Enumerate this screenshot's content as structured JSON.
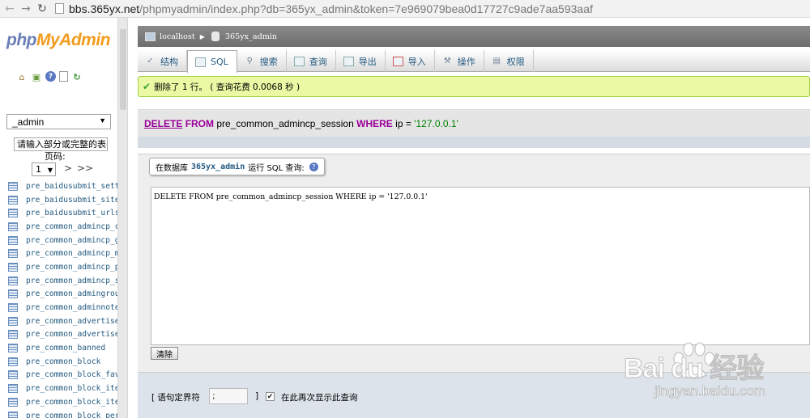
{
  "browser": {
    "url_host": "bbs.365yx.net",
    "url_rest": "/phpmyadmin/index.php?db=365yx_admin&token=7e969079bea0d17727c9ade7aa593aaf"
  },
  "sidebar": {
    "logo": {
      "php": "php",
      "my": "My",
      "admin": "Admin"
    },
    "db_selected": "_admin",
    "filter_placeholder": "请输入部分或完整的表名",
    "page_label": "页码:",
    "page_value": "1",
    "page_next": ">",
    "page_last": ">>",
    "tables": [
      "pre_baidusubmit_setting",
      "pre_baidusubmit_sitemap",
      "pre_baidusubmit_urlstat",
      "pre_common_admincp_cmenu",
      "pre_common_admincp_group",
      "pre_common_admincp_member",
      "pre_common_admincp_perm",
      "pre_common_admincp_session",
      "pre_common_admingroup",
      "pre_common_adminnote",
      "pre_common_advertisement",
      "pre_common_advertisement_custom",
      "pre_common_banned",
      "pre_common_block",
      "pre_common_block_favorite",
      "pre_common_block_item",
      "pre_common_block_item_data",
      "pre_common_block_permission",
      "pre_common_block_pic"
    ]
  },
  "breadcrumb": {
    "server": "localhost",
    "database": "365yx_admin"
  },
  "tabs": [
    {
      "label": "结构"
    },
    {
      "label": "SQL"
    },
    {
      "label": "搜索"
    },
    {
      "label": "查询"
    },
    {
      "label": "导出"
    },
    {
      "label": "导入"
    },
    {
      "label": "操作"
    },
    {
      "label": "权限"
    }
  ],
  "message": {
    "text": "删除了 1 行。 ( 查询花费 0.0068 秒 )"
  },
  "sql_display": {
    "kw_delete": "DELETE",
    "kw_from": "FROM",
    "table": "pre_common_admincp_session",
    "kw_where": "WHERE",
    "column": "ip",
    "op": "=",
    "value": "'127.0.0.1'"
  },
  "query_panel": {
    "legend_prefix": "在数据库",
    "legend_db": "365yx_admin",
    "legend_suffix": "运行 SQL 查询:",
    "query_text": "DELETE FROM pre_common_admincp_session WHERE ip = '127.0.0.1'",
    "clear_label": "清除"
  },
  "options": {
    "delimiter_label": "[ 语句定界符",
    "delimiter_value": ";",
    "delimiter_close": "]",
    "show_again_label": "在此再次显示此查询",
    "show_again_checked": true
  },
  "watermark": {
    "brand": "Bai du 经验",
    "site": "jingyan.baidu.com"
  }
}
